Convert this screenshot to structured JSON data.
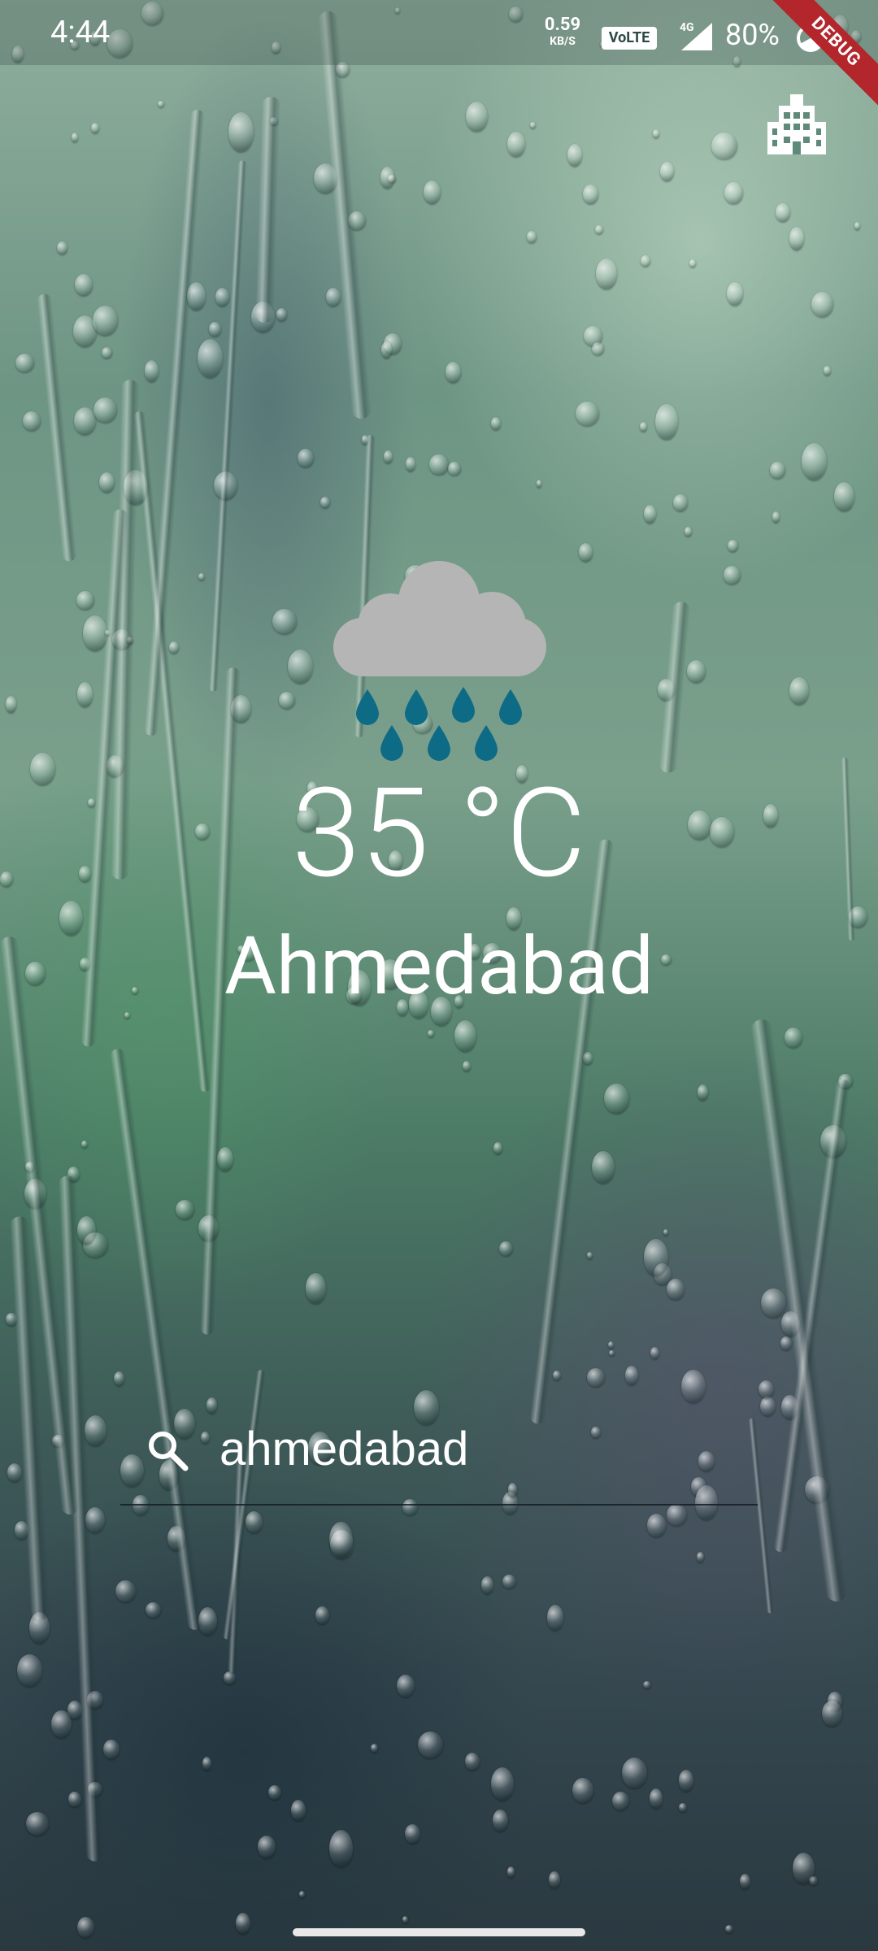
{
  "status_bar": {
    "time": "4:44",
    "net_speed_value": "0.59",
    "net_speed_unit": "KB/S",
    "volte_label": "VoLTE",
    "network_type": "4G",
    "battery": "80%",
    "debug_label": "DEBUG"
  },
  "weather": {
    "icon": "cloud-rain-icon",
    "temperature": "35 °C",
    "city": "Ahmedabad"
  },
  "search": {
    "value": "ahmedabad",
    "icon": "search-icon"
  },
  "actions": {
    "city_button_icon": "city-buildings-icon"
  },
  "colors": {
    "text": "#ffffff",
    "cloud": "#b5b5b5",
    "rain_drop": "#0e6b86",
    "debug_banner": "#b3262c"
  }
}
